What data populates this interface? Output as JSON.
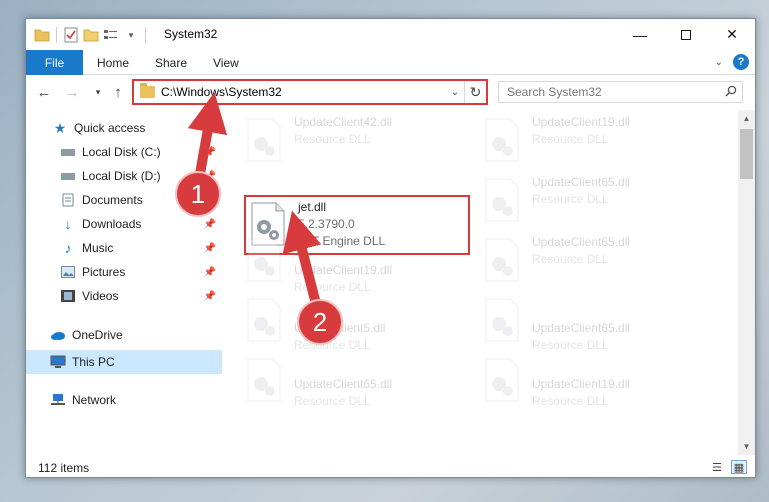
{
  "window": {
    "title": "System32"
  },
  "ribbon": {
    "tabs": [
      {
        "label": "File"
      },
      {
        "label": "Home"
      },
      {
        "label": "Share"
      },
      {
        "label": "View"
      }
    ]
  },
  "address": {
    "path": "C:\\Windows\\System32"
  },
  "search": {
    "placeholder": "Search System32"
  },
  "nav": {
    "items": [
      {
        "label": "Quick access"
      },
      {
        "label": "Local Disk (C:)"
      },
      {
        "label": "Local Disk (D:)"
      },
      {
        "label": "Documents"
      },
      {
        "label": "Downloads"
      },
      {
        "label": "Music"
      },
      {
        "label": "Pictures"
      },
      {
        "label": "Videos"
      },
      {
        "label": "OneDrive"
      },
      {
        "label": "This PC"
      },
      {
        "label": "Network"
      }
    ]
  },
  "files": {
    "f0": {
      "name": "UpdateClient42.dll",
      "type": "Resource DLL"
    },
    "f1": {
      "name": "UpdateClient19.dll",
      "type": "Resource DLL"
    },
    "jet": {
      "name": "jet.dll",
      "version": "5.2.3790.0",
      "type": "JET Engine DLL"
    },
    "f3": {
      "name": "UpdateClient65.dll",
      "type": "Resource DLL"
    },
    "f4": {
      "name": "UpdateClient19.dll",
      "type": "Resource DLL"
    },
    "f5": {
      "name": "UpdateClient65.dll",
      "type": "Resource DLL"
    },
    "f6": {
      "name": "UpdateClient5.dll",
      "type": "Resource DLL"
    },
    "f7": {
      "name": "UpdateClient65.dll",
      "type": "Resource DLL"
    },
    "f8": {
      "name": "UpdateClient65.dll",
      "type": "Resource DLL"
    },
    "f9": {
      "name": "UpdateClient19.dll",
      "type": "Resource DLL"
    }
  },
  "status": {
    "count": "112 items"
  },
  "annotations": {
    "step1": "1",
    "step2": "2"
  },
  "colors": {
    "accent": "#1979ca",
    "highlight": "#d9393b",
    "selection": "#cce8ff"
  }
}
